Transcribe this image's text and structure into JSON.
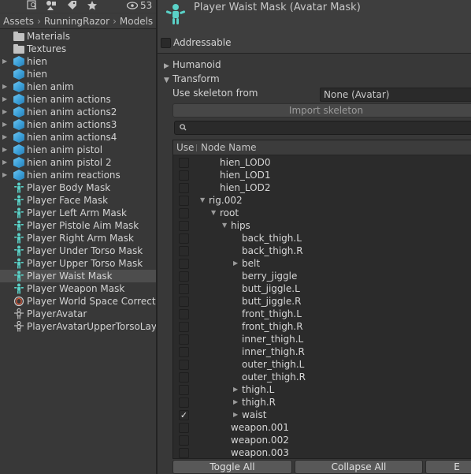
{
  "project": {
    "toolbar_count": "53",
    "breadcrumb": [
      "Assets",
      "RunningRazor",
      "Models"
    ],
    "items": [
      {
        "label": "Materials",
        "icon": "folder-icon",
        "expandable": false,
        "selected": false
      },
      {
        "label": "Textures",
        "icon": "folder-icon",
        "expandable": false,
        "selected": false
      },
      {
        "label": "hien",
        "icon": "model-icon",
        "expandable": true,
        "selected": false
      },
      {
        "label": "hien",
        "icon": "model-icon",
        "expandable": false,
        "selected": false
      },
      {
        "label": "hien anim",
        "icon": "model-icon",
        "expandable": true,
        "selected": false
      },
      {
        "label": "hien anim actions",
        "icon": "model-icon",
        "expandable": true,
        "selected": false
      },
      {
        "label": "hien anim actions2",
        "icon": "model-icon",
        "expandable": true,
        "selected": false
      },
      {
        "label": "hien anim actions3",
        "icon": "model-icon",
        "expandable": true,
        "selected": false
      },
      {
        "label": "hien anim actions4",
        "icon": "model-icon",
        "expandable": true,
        "selected": false
      },
      {
        "label": "hien anim pistol",
        "icon": "model-icon",
        "expandable": true,
        "selected": false
      },
      {
        "label": "hien anim pistol 2",
        "icon": "model-icon",
        "expandable": true,
        "selected": false
      },
      {
        "label": "hien anim reactions",
        "icon": "model-icon",
        "expandable": true,
        "selected": false
      },
      {
        "label": "Player Body Mask",
        "icon": "avatar-mask-icon",
        "expandable": false,
        "selected": false
      },
      {
        "label": "Player Face Mask",
        "icon": "avatar-mask-icon",
        "expandable": false,
        "selected": false
      },
      {
        "label": "Player Left Arm Mask",
        "icon": "avatar-mask-icon",
        "expandable": false,
        "selected": false
      },
      {
        "label": "Player Pistole Aim Mask",
        "icon": "avatar-mask-icon",
        "expandable": false,
        "selected": false
      },
      {
        "label": "Player Right Arm Mask",
        "icon": "avatar-mask-icon",
        "expandable": false,
        "selected": false
      },
      {
        "label": "Player Under Torso Mask",
        "icon": "avatar-mask-icon",
        "expandable": false,
        "selected": false
      },
      {
        "label": "Player Upper Torso Mask",
        "icon": "avatar-mask-icon",
        "expandable": false,
        "selected": false
      },
      {
        "label": "Player Waist Mask",
        "icon": "avatar-mask-icon",
        "expandable": false,
        "selected": true
      },
      {
        "label": "Player Weapon Mask",
        "icon": "avatar-mask-icon",
        "expandable": false,
        "selected": false
      },
      {
        "label": "Player World Space Corrector",
        "icon": "script-asset-icon",
        "expandable": false,
        "selected": false
      },
      {
        "label": "PlayerAvatar",
        "icon": "avatar-icon",
        "expandable": false,
        "selected": false
      },
      {
        "label": "PlayerAvatarUpperTorsoLayer",
        "icon": "avatar-icon",
        "expandable": false,
        "selected": false
      }
    ]
  },
  "inspector": {
    "title": "Player Waist Mask (Avatar Mask)",
    "addressable_label": "Addressable",
    "addressable_checked": false,
    "sections": {
      "humanoid": "Humanoid",
      "transform": "Transform"
    },
    "skeleton_label": "Use skeleton from",
    "skeleton_value": "None (Avatar)",
    "import_button": "Import skeleton",
    "search_value": "",
    "table": {
      "col_use": "Use",
      "col_name": "Node Name",
      "rows": [
        {
          "name": "hien_LOD0",
          "depth": 1,
          "arrow": "",
          "checked": false
        },
        {
          "name": "hien_LOD1",
          "depth": 1,
          "arrow": "",
          "checked": false
        },
        {
          "name": "hien_LOD2",
          "depth": 1,
          "arrow": "",
          "checked": false
        },
        {
          "name": "rig.002",
          "depth": 0,
          "arrow": "down",
          "checked": false
        },
        {
          "name": "root",
          "depth": 1,
          "arrow": "down",
          "checked": false
        },
        {
          "name": "hips",
          "depth": 2,
          "arrow": "down",
          "checked": false
        },
        {
          "name": "back_thigh.L",
          "depth": 3,
          "arrow": "",
          "checked": false
        },
        {
          "name": "back_thigh.R",
          "depth": 3,
          "arrow": "",
          "checked": false
        },
        {
          "name": "belt",
          "depth": 3,
          "arrow": "right",
          "checked": false
        },
        {
          "name": "berry_jiggle",
          "depth": 3,
          "arrow": "",
          "checked": false
        },
        {
          "name": "butt_jiggle.L",
          "depth": 3,
          "arrow": "",
          "checked": false
        },
        {
          "name": "butt_jiggle.R",
          "depth": 3,
          "arrow": "",
          "checked": false
        },
        {
          "name": "front_thigh.L",
          "depth": 3,
          "arrow": "",
          "checked": false
        },
        {
          "name": "front_thigh.R",
          "depth": 3,
          "arrow": "",
          "checked": false
        },
        {
          "name": "inner_thigh.L",
          "depth": 3,
          "arrow": "",
          "checked": false
        },
        {
          "name": "inner_thigh.R",
          "depth": 3,
          "arrow": "",
          "checked": false
        },
        {
          "name": "outer_thigh.L",
          "depth": 3,
          "arrow": "",
          "checked": false
        },
        {
          "name": "outer_thigh.R",
          "depth": 3,
          "arrow": "",
          "checked": false
        },
        {
          "name": "thigh.L",
          "depth": 3,
          "arrow": "right",
          "checked": false
        },
        {
          "name": "thigh.R",
          "depth": 3,
          "arrow": "right",
          "checked": false
        },
        {
          "name": "waist",
          "depth": 3,
          "arrow": "right",
          "checked": true
        },
        {
          "name": "weapon.001",
          "depth": 2,
          "arrow": "",
          "checked": false
        },
        {
          "name": "weapon.002",
          "depth": 2,
          "arrow": "",
          "checked": false
        },
        {
          "name": "weapon.003",
          "depth": 2,
          "arrow": "",
          "checked": false
        }
      ]
    },
    "buttons": {
      "toggle_all": "Toggle All",
      "collapse_all": "Collapse All",
      "expand_all_partial": "E"
    }
  },
  "colors": {
    "panel_bg": "#383838",
    "selection_bg": "#4d4d4d",
    "model_icon": "#3a9fd8",
    "avatar_icon": "#5ad2c8"
  }
}
